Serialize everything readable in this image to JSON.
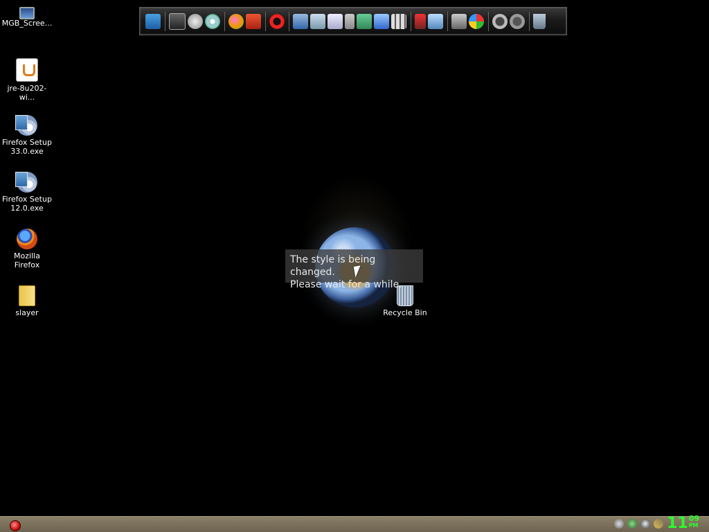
{
  "desktop": {
    "icons": [
      {
        "label": "MGB_Scree...",
        "icon": "monitor-icon"
      },
      {
        "label": "jre-8u202-wi...",
        "icon": "java-icon"
      },
      {
        "label": "Firefox Setup\n33.0.exe",
        "label_line1": "Firefox Setup",
        "label_line2": "33.0.exe",
        "icon": "setup-icon"
      },
      {
        "label_line1": "Firefox Setup",
        "label_line2": "12.0.exe",
        "icon": "setup-icon"
      },
      {
        "label_line1": "Mozilla",
        "label_line2": "Firefox",
        "icon": "firefox-icon"
      },
      {
        "label": "slayer",
        "icon": "folder-icon"
      },
      {
        "label": "Recycle Bin",
        "icon": "recycle-bin-icon"
      }
    ]
  },
  "dock": {
    "apps": [
      "media-player-icon",
      "clapper-icon",
      "flash-icon",
      "disc-burner-icon",
      "paint-palette-icon",
      "book-icon",
      "ccleaner-icon",
      "network-icon",
      "document-icon",
      "notepad-icon",
      "scissors-icon",
      "cube-icon",
      "window-icon",
      "grid-icon",
      "usb-icon",
      "display-icon",
      "control-panel-icon",
      "windows-update-icon",
      "power-icon",
      "back-icon",
      "trash-icon"
    ]
  },
  "splash": {
    "message_line1": "The style is being changed.",
    "message_line2": "Please wait for a while."
  },
  "taskbar": {
    "tray_icons": [
      "speaker-icon",
      "network-tray-icon",
      "shield-tray-icon",
      "tool-tray-icon"
    ],
    "clock_hour": "11",
    "clock_minute": "09",
    "clock_ampm": "PM"
  },
  "colors": {
    "desktop_bg": "#000000",
    "taskbar_bg": "#7c725c",
    "clock": "#2cff2c",
    "start_button": "#c41010"
  }
}
